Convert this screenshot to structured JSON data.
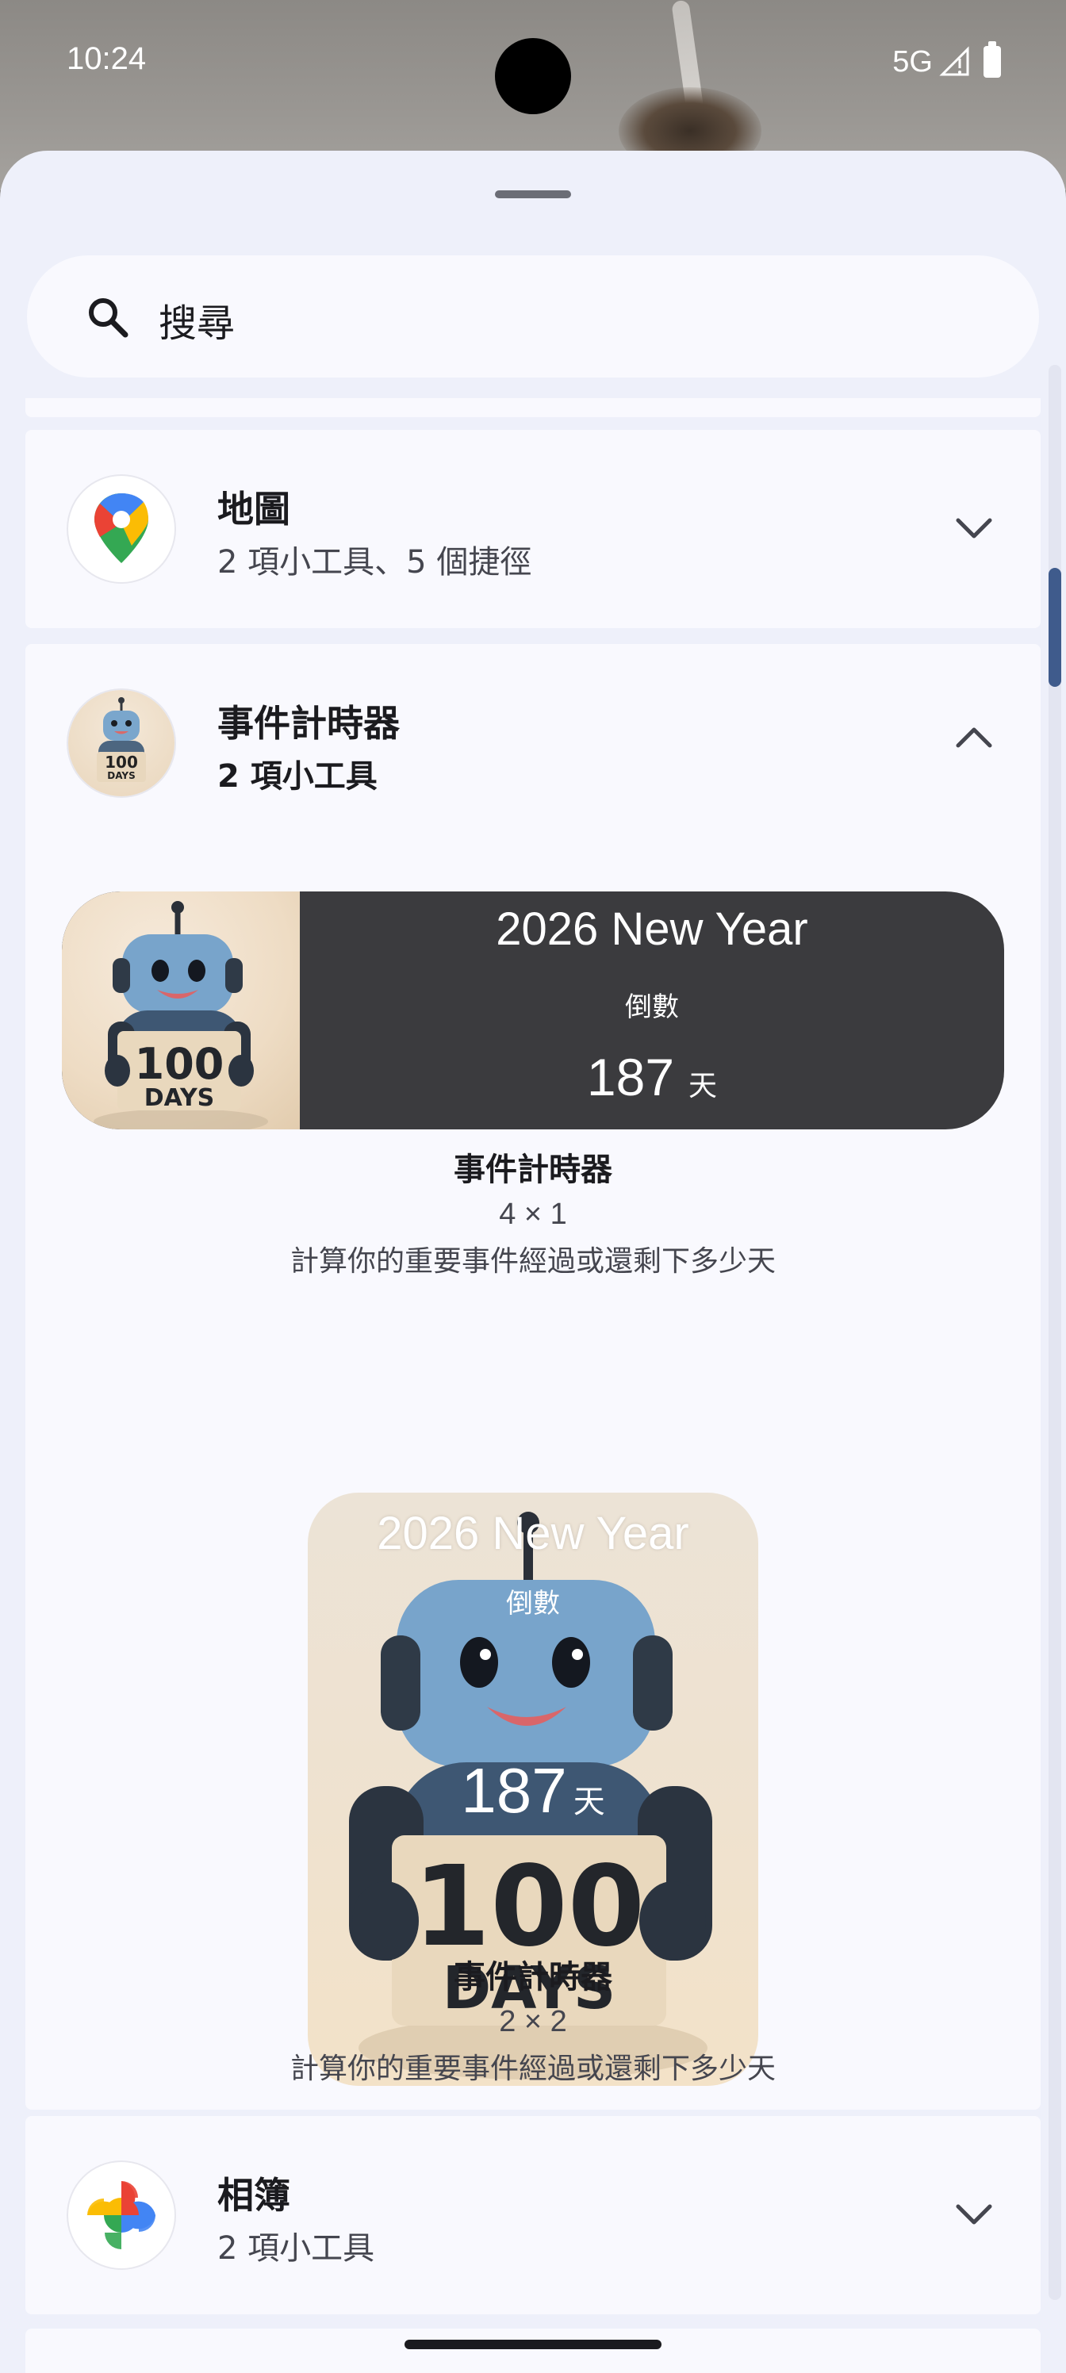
{
  "status_bar": {
    "time": "10:24",
    "network": "5G"
  },
  "search": {
    "placeholder": "搜尋"
  },
  "apps": [
    {
      "name": "地圖",
      "subtitle": "2 項小工具、5 個捷徑",
      "expanded": false,
      "icon": "google-maps-icon"
    },
    {
      "name": "事件計時器",
      "subtitle": "2 項小工具",
      "expanded": true,
      "icon": "robot-100-days-icon",
      "widgets": [
        {
          "preview": {
            "event_title": "2026 New Year",
            "label": "倒數",
            "count": "187",
            "unit": "天"
          },
          "name": "事件計時器",
          "size": "4 × 1",
          "description": "計算你的重要事件經過或還剩下多少天"
        },
        {
          "preview": {
            "event_title": "2026 New Year",
            "label": "倒數",
            "count": "187",
            "unit": "天",
            "sign_line1": "100",
            "sign_line2": "DAYS"
          },
          "name": "事件計時器",
          "size": "2 × 2",
          "description": "計算你的重要事件經過或還剩下多少天"
        }
      ]
    },
    {
      "name": "相簿",
      "subtitle": "2 項小工具",
      "expanded": false,
      "icon": "google-photos-icon"
    }
  ],
  "colors": {
    "sheet_background": "#eef0fa",
    "card_background": "#f9f9fe",
    "wide_widget_background": "#3b3b3e",
    "scrollbar_thumb": "#3f5b8c"
  }
}
